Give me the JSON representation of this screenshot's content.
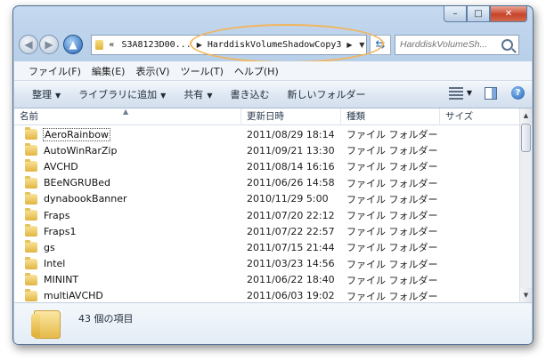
{
  "window": {
    "caption_buttons": {
      "minimize": "–",
      "maximize": "□",
      "close": "✕"
    }
  },
  "address": {
    "prefix": "«",
    "crumbs": [
      "S3A8123D00...",
      "HarddiskVolumeShadowCopy3"
    ],
    "search_placeholder": "HarddiskVolumeSh..."
  },
  "menu": [
    "ファイル(F)",
    "編集(E)",
    "表示(V)",
    "ツール(T)",
    "ヘルプ(H)"
  ],
  "toolbar": {
    "organize": "整理",
    "include_library": "ライブラリに追加",
    "share": "共有",
    "burn": "書き込む",
    "new_folder": "新しいフォルダー"
  },
  "columns": {
    "name": "名前",
    "date": "更新日時",
    "type": "種類",
    "size": "サイズ"
  },
  "rows": [
    {
      "name": "AeroRainbow",
      "date": "2011/08/29 18:14",
      "type": "ファイル フォルダー"
    },
    {
      "name": "AutoWinRarZip",
      "date": "2011/09/21 13:30",
      "type": "ファイル フォルダー"
    },
    {
      "name": "AVCHD",
      "date": "2011/08/14 16:16",
      "type": "ファイル フォルダー"
    },
    {
      "name": "BEeNGRUBed",
      "date": "2011/06/26 14:58",
      "type": "ファイル フォルダー"
    },
    {
      "name": "dynabookBanner",
      "date": "2010/11/29 5:00",
      "type": "ファイル フォルダー"
    },
    {
      "name": "Fraps",
      "date": "2011/07/20 22:12",
      "type": "ファイル フォルダー"
    },
    {
      "name": "Fraps1",
      "date": "2011/07/22 22:57",
      "type": "ファイル フォルダー"
    },
    {
      "name": "gs",
      "date": "2011/07/15 21:44",
      "type": "ファイル フォルダー"
    },
    {
      "name": "Intel",
      "date": "2011/03/23 14:56",
      "type": "ファイル フォルダー"
    },
    {
      "name": "MININT",
      "date": "2011/06/22 18:40",
      "type": "ファイル フォルダー"
    },
    {
      "name": "multiAVCHD",
      "date": "2011/06/03 19:02",
      "type": "ファイル フォルダー"
    }
  ],
  "status": {
    "item_count": "43 個の項目"
  },
  "colors": {
    "highlight_ring": "#f2b55c",
    "window_frame": "#b8cfe9"
  }
}
